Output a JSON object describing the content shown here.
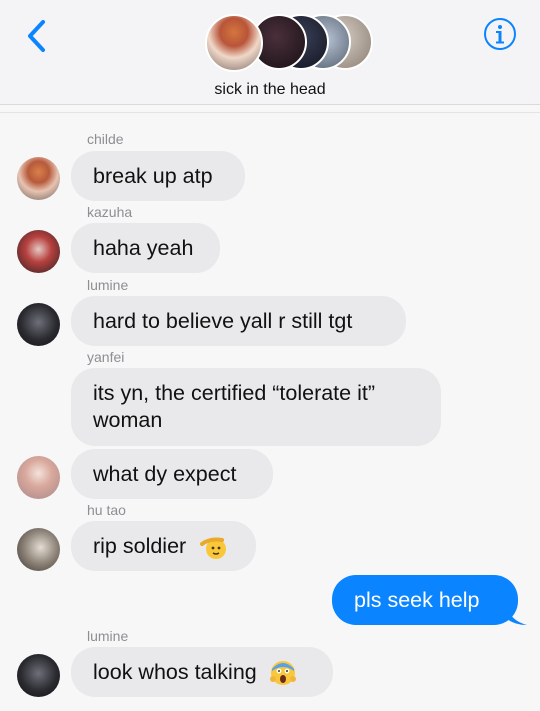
{
  "header": {
    "group_name": "sick in the head",
    "back_icon": "chevron-left-icon",
    "info_icon": "info-circle-icon",
    "accent_color": "#0b84ff"
  },
  "messages": [
    {
      "sender": "childe",
      "text": "break up atp"
    },
    {
      "sender": "kazuha",
      "text": "haha yeah"
    },
    {
      "sender": "lumine",
      "text": "hard to believe yall r still tgt"
    },
    {
      "sender": "yanfei",
      "text": "its yn, the certified “tolerate it” woman"
    },
    {
      "sender": "",
      "text": "what dy expect"
    },
    {
      "sender": "hu tao",
      "text": "rip soldier",
      "emoji": "saluting-face-emoji"
    },
    {
      "sender": "",
      "text": "pls seek help",
      "outgoing": true
    },
    {
      "sender": "lumine",
      "text": "look whos talking",
      "emoji": "screaming-face-emoji"
    }
  ]
}
